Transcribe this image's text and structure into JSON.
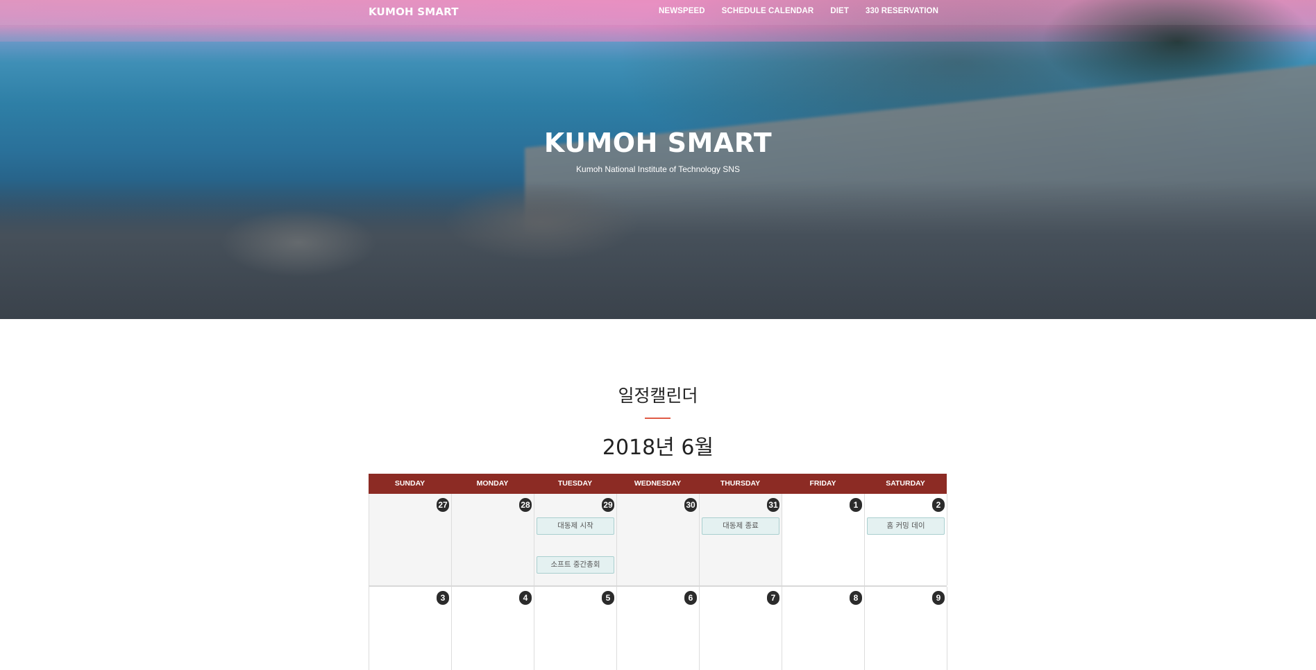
{
  "nav": {
    "brand": "KUMOH SMART",
    "links": [
      "NEWSPEED",
      "SCHEDULE CALENDAR",
      "DIET",
      "330 RESERVATION"
    ]
  },
  "hero": {
    "title": "KUMOH SMART",
    "subtitle": "Kumoh National Institute of Technology SNS"
  },
  "calendar": {
    "section_title": "일정캘린더",
    "month_title": "2018년 6월",
    "weekdays": [
      "SUNDAY",
      "MONDAY",
      "TUESDAY",
      "WEDNESDAY",
      "THURSDAY",
      "FRIDAY",
      "SATURDAY"
    ],
    "weeks": [
      [
        {
          "day": "27",
          "other_month": true,
          "events": []
        },
        {
          "day": "28",
          "other_month": true,
          "events": []
        },
        {
          "day": "29",
          "other_month": true,
          "events": [
            "대동제 시작",
            "소프트 중간총회"
          ]
        },
        {
          "day": "30",
          "other_month": true,
          "events": []
        },
        {
          "day": "31",
          "other_month": true,
          "events": [
            "대동제 종료"
          ]
        },
        {
          "day": "1",
          "other_month": false,
          "events": []
        },
        {
          "day": "2",
          "other_month": false,
          "events": [
            "홈 커밍 데이"
          ]
        }
      ],
      [
        {
          "day": "3",
          "other_month": false,
          "events": []
        },
        {
          "day": "4",
          "other_month": false,
          "events": []
        },
        {
          "day": "5",
          "other_month": false,
          "events": []
        },
        {
          "day": "6",
          "other_month": false,
          "events": []
        },
        {
          "day": "7",
          "other_month": false,
          "events": []
        },
        {
          "day": "8",
          "other_month": false,
          "events": []
        },
        {
          "day": "9",
          "other_month": false,
          "events": []
        }
      ]
    ]
  },
  "colors": {
    "header_bar": "#8c2b24",
    "accent_divider": "#e05a45",
    "event_bg": "#e4f1f1",
    "event_border": "#a9cfcf"
  }
}
